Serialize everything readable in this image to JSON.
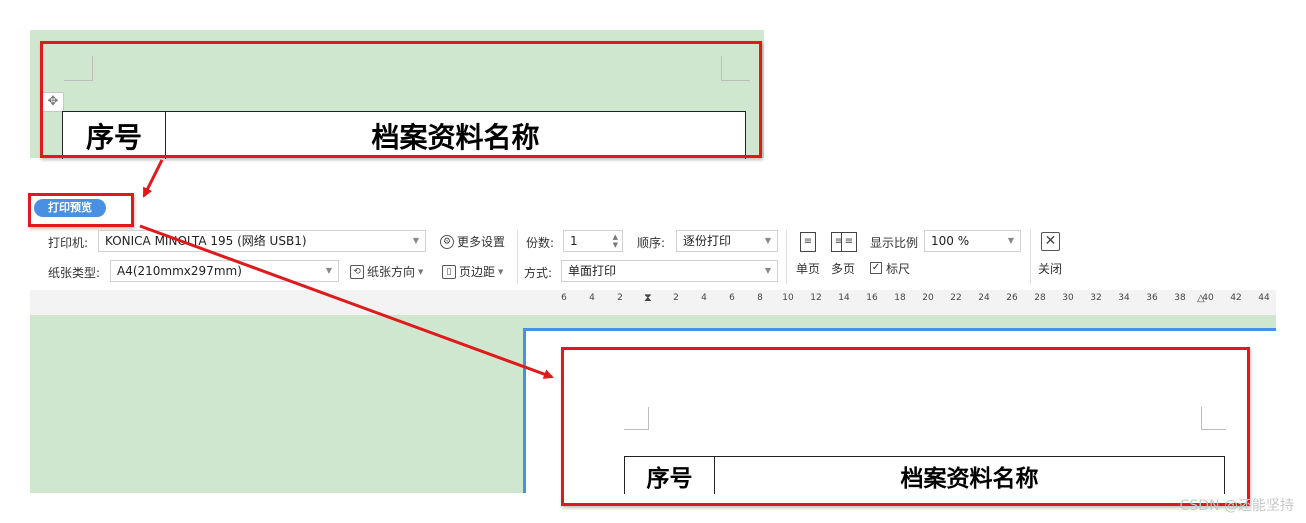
{
  "document_top": {
    "table_headers": [
      "序号",
      "档案资料名称"
    ]
  },
  "print_preview_tab": "打印预览",
  "toolbar": {
    "printer_label": "打印机:",
    "printer_value": "KONICA MINOLTA 195 (网络 USB1)",
    "more_settings": "更多设置",
    "copies_label": "份数:",
    "copies_value": "1",
    "order_label": "顺序:",
    "order_value": "逐份打印",
    "paper_type_label": "纸张类型:",
    "paper_type_value": "A4(210mmx297mm)",
    "paper_orientation": "纸张方向",
    "margins": "页边距",
    "mode_label": "方式:",
    "mode_value": "单面打印",
    "single_page": "单页",
    "multi_page": "多页",
    "zoom_label": "显示比例",
    "zoom_value": "100 %",
    "ruler_checkbox": "标尺",
    "close": "关闭"
  },
  "ruler_ticks": [
    "6",
    "4",
    "2",
    "2",
    "4",
    "6",
    "8",
    "10",
    "12",
    "14",
    "16",
    "18",
    "20",
    "22",
    "24",
    "26",
    "28",
    "30",
    "32",
    "34",
    "36",
    "38",
    "40",
    "42",
    "44"
  ],
  "preview_page": {
    "table_headers": [
      "序号",
      "档案资料名称"
    ]
  },
  "watermark": "CSDN @还能坚持",
  "colors": {
    "highlight_red": "#e0191b",
    "accent_blue": "#4a90e2",
    "document_bg": "#cfe6cf"
  }
}
